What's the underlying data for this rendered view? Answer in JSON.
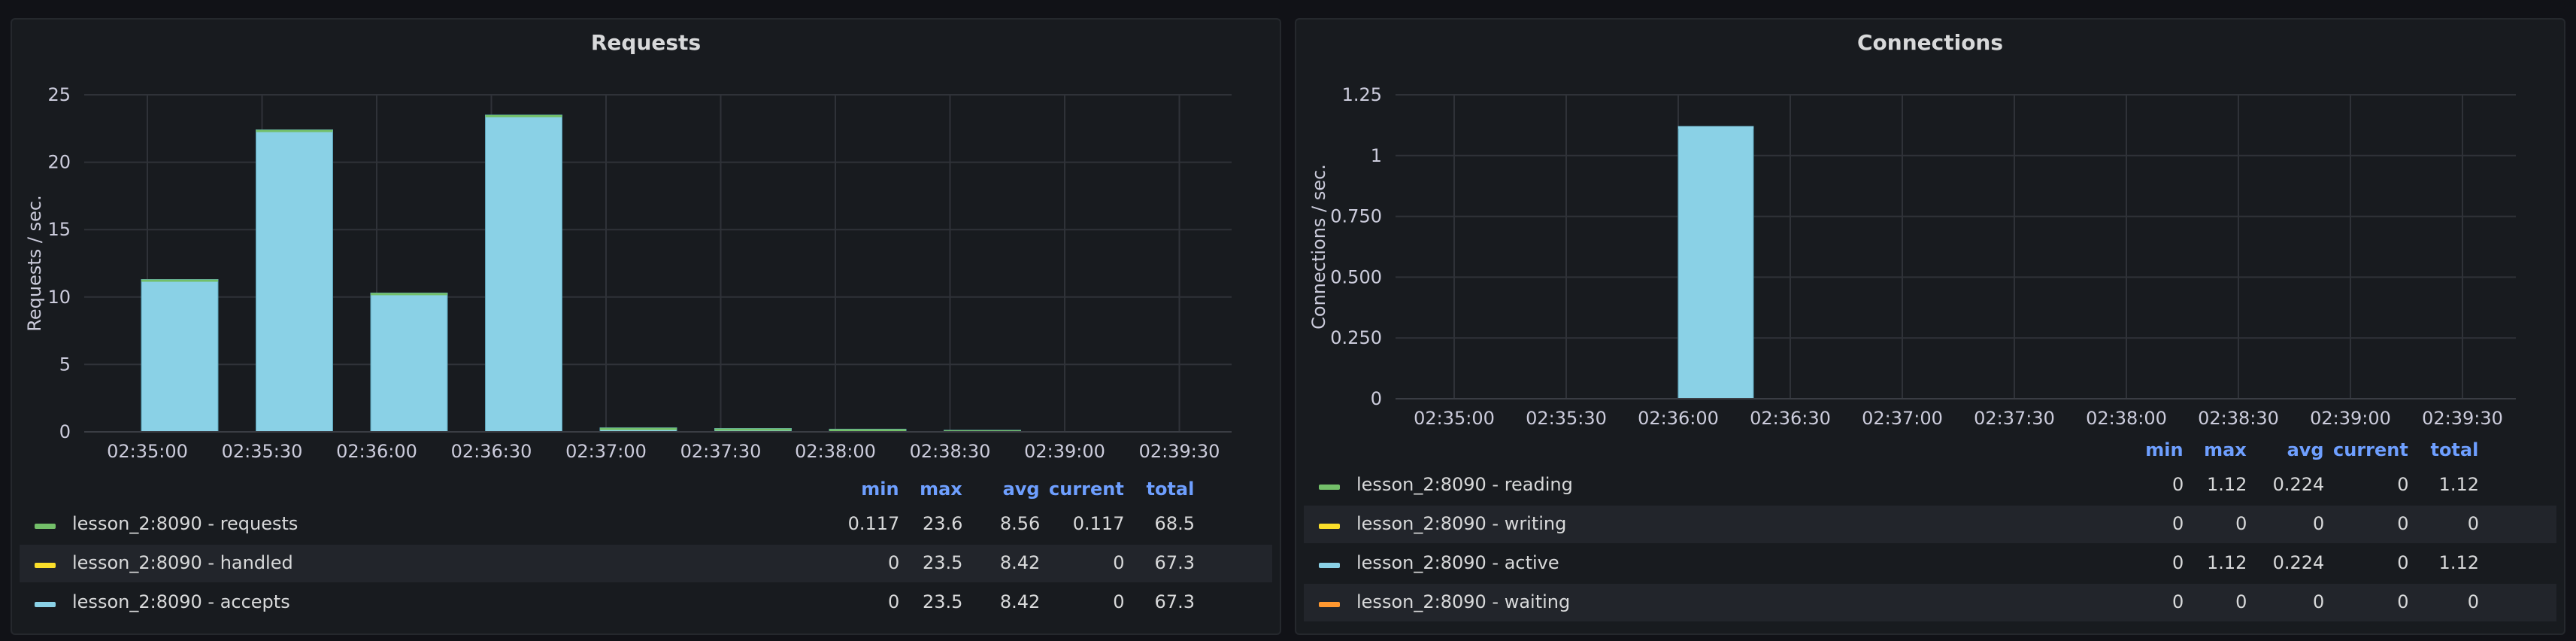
{
  "panels": {
    "left": {
      "title": "Requests",
      "legend_headers": [
        "min",
        "max",
        "avg",
        "current",
        "total"
      ],
      "legend": [
        {
          "name": "lesson_2:8090 - requests",
          "color": "#73bf69",
          "min": "0.117",
          "max": "23.6",
          "avg": "8.56",
          "current": "0.117",
          "total": "68.5"
        },
        {
          "name": "lesson_2:8090 - handled",
          "color": "#fade2a",
          "min": "0",
          "max": "23.5",
          "avg": "8.42",
          "current": "0",
          "total": "67.3"
        },
        {
          "name": "lesson_2:8090 - accepts",
          "color": "#8ad1e6",
          "min": "0",
          "max": "23.5",
          "avg": "8.42",
          "current": "0",
          "total": "67.3"
        }
      ]
    },
    "right": {
      "title": "Connections",
      "legend_headers": [
        "min",
        "max",
        "avg",
        "current",
        "total"
      ],
      "legend": [
        {
          "name": "lesson_2:8090 - reading",
          "color": "#73bf69",
          "min": "0",
          "max": "1.12",
          "avg": "0.224",
          "current": "0",
          "total": "1.12"
        },
        {
          "name": "lesson_2:8090 - writing",
          "color": "#fade2a",
          "min": "0",
          "max": "0",
          "avg": "0",
          "current": "0",
          "total": "0"
        },
        {
          "name": "lesson_2:8090 - active",
          "color": "#8ad1e6",
          "min": "0",
          "max": "1.12",
          "avg": "0.224",
          "current": "0",
          "total": "1.12"
        },
        {
          "name": "lesson_2:8090 - waiting",
          "color": "#ff9830",
          "min": "0",
          "max": "0",
          "avg": "0",
          "current": "0",
          "total": "0"
        }
      ]
    }
  },
  "chart_data": [
    {
      "type": "bar",
      "title": "Requests",
      "ylabel": "Requests / sec.",
      "xlabel": "",
      "ylim": [
        0,
        25
      ],
      "yticks": [
        "0",
        "5",
        "10",
        "15",
        "20",
        "25"
      ],
      "yticks_values": [
        0,
        5,
        10,
        15,
        20,
        25
      ],
      "xticks": [
        "02:35:00",
        "02:35:30",
        "02:36:00",
        "02:36:30",
        "02:37:00",
        "02:37:30",
        "02:38:00",
        "02:38:30",
        "02:39:00",
        "02:39:30"
      ],
      "bar_color": "#8ad1e6",
      "top_color": "#73bf69",
      "values": [
        11.3,
        22.4,
        10.3,
        23.5,
        0.3,
        0.25,
        0.2,
        0.12,
        0,
        0
      ],
      "grid": true
    },
    {
      "type": "bar",
      "title": "Connections",
      "ylabel": "Connections / sec.",
      "xlabel": "",
      "ylim": [
        0,
        1.25
      ],
      "yticks": [
        "0",
        "0.250",
        "0.500",
        "0.750",
        "1",
        "1.25"
      ],
      "yticks_values": [
        0,
        0.25,
        0.5,
        0.75,
        1,
        1.25
      ],
      "xticks": [
        "02:35:00",
        "02:35:30",
        "02:36:00",
        "02:36:30",
        "02:37:00",
        "02:37:30",
        "02:38:00",
        "02:38:30",
        "02:39:00",
        "02:39:30"
      ],
      "bar_color": "#8ad1e6",
      "top_color": "#8ad1e6",
      "values": [
        0,
        0,
        1.12,
        0,
        0,
        0,
        0,
        0,
        0,
        0
      ],
      "grid": true
    }
  ]
}
